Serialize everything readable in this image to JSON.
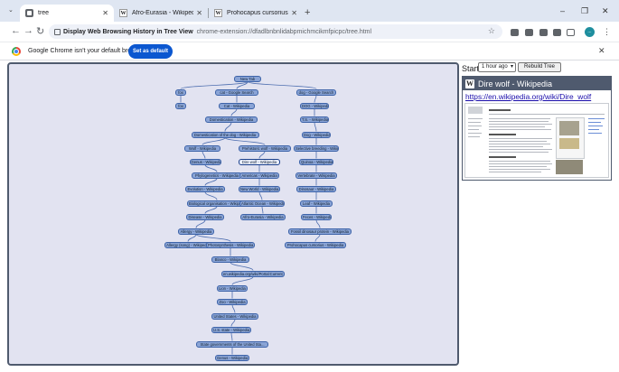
{
  "tabs": [
    {
      "title": "tree",
      "icon": "tree-extension-icon",
      "active": true
    },
    {
      "title": "Afro-Eurasia - Wikipedia",
      "icon": "wikipedia-icon",
      "active": false
    },
    {
      "title": "Prohocapus cursorius - Wikip",
      "icon": "wikipedia-icon",
      "active": false
    }
  ],
  "omnibox": {
    "chip_label": "Display Web Browsing History in Tree View",
    "url": "chrome-extension://dfadlbnbnlidabpmichmcikmfpicpc/tree.html"
  },
  "infobar": {
    "message": "Google Chrome isn't your default browser",
    "button": "Set as default"
  },
  "profile": {
    "initials": "..."
  },
  "controls": {
    "start_label": "Start",
    "start_value": "1 hour ago",
    "rebuild_label": "Rebuild Tree"
  },
  "preview": {
    "title": "Dire wolf - Wikipedia",
    "link": "https://en.wikipedia.org/wiki/Dire_wolf",
    "wiki_letter": "W"
  },
  "tree": {
    "nodes": [
      {
        "id": "root",
        "label": "New Tab"
      },
      {
        "id": "a1",
        "label": "fox",
        "parent": "root"
      },
      {
        "id": "a2",
        "label": "fox",
        "parent": "a1"
      },
      {
        "id": "b1",
        "label": "cat - Google Search",
        "parent": "root"
      },
      {
        "id": "b2",
        "label": "Cat - Wikipedia",
        "parent": "b1"
      },
      {
        "id": "b3",
        "label": "Domestication - Wikipedia",
        "parent": "b2"
      },
      {
        "id": "b4",
        "label": "Domestication of the dog - Wikipedia",
        "parent": "b3"
      },
      {
        "id": "b5",
        "label": "Wolf - Wikipedia",
        "parent": "b4"
      },
      {
        "id": "b6",
        "label": "Genus - Wikipedia",
        "parent": "b5"
      },
      {
        "id": "b7",
        "label": "Phylogenetics - Wikipedia",
        "parent": "b6"
      },
      {
        "id": "b8",
        "label": "Evolution - Wikipedia",
        "parent": "b7"
      },
      {
        "id": "b9",
        "label": "Biological organisation - Wikipedia",
        "parent": "b8"
      },
      {
        "id": "b10",
        "label": "Disease - Wikipedia",
        "parent": "b9"
      },
      {
        "id": "b11",
        "label": "Allergy - Wikipedia",
        "parent": "b10"
      },
      {
        "id": "b12a",
        "label": "Allergy (song) - Wikipedia",
        "parent": "b11"
      },
      {
        "id": "b12b",
        "label": "Photosynthesis - Wikipedia",
        "parent": "b11"
      },
      {
        "id": "b13",
        "label": "Blanco - Wikipedia",
        "parent": "b12b"
      },
      {
        "id": "b14",
        "label": "en.wikipedia.org/wiki/Portal:Current_events",
        "parent": "b13"
      },
      {
        "id": "b15",
        "label": "Lion - Wikipedia",
        "parent": "b14"
      },
      {
        "id": "b16",
        "label": "Zoo - Wikipedia",
        "parent": "b15"
      },
      {
        "id": "b17",
        "label": "United States - Wikipedia",
        "parent": "b16"
      },
      {
        "id": "b18",
        "label": "U.S. state - Wikipedia",
        "parent": "b17"
      },
      {
        "id": "b19",
        "label": "State governments of the United Sta...",
        "parent": "b18"
      },
      {
        "id": "b20",
        "label": "Genus - Wikipedia",
        "parent": "b19"
      },
      {
        "id": "c5",
        "label": "Prehistoric wolf - Wikipedia",
        "parent": "b4"
      },
      {
        "id": "c6",
        "label": "Dire wolf - Wikipedia",
        "parent": "c5",
        "selected": true
      },
      {
        "id": "c7",
        "label": "Americas - Wikipedia",
        "parent": "c6"
      },
      {
        "id": "c8",
        "label": "New World - Wikipedia",
        "parent": "c7"
      },
      {
        "id": "c9",
        "label": "Atlantic Ocean - Wikipedia",
        "parent": "c8"
      },
      {
        "id": "c10",
        "label": "Afro-Eurasia - Wikipedia",
        "parent": "c9"
      },
      {
        "id": "d1",
        "label": "dog - Google Search",
        "parent": "root"
      },
      {
        "id": "d2",
        "label": "DOG - Wikipedia",
        "parent": "d1"
      },
      {
        "id": "d3",
        "label": "T.S. - Wikipedia",
        "parent": "d2"
      },
      {
        "id": "d4",
        "label": "Dog - Wikipedia",
        "parent": "d3"
      },
      {
        "id": "d5",
        "label": "Selective breeding - Wikipedia",
        "parent": "d4"
      },
      {
        "id": "d6",
        "label": "Quinoa - Wikipedia",
        "parent": "d5"
      },
      {
        "id": "d7",
        "label": "Vertebrate - Wikipedia",
        "parent": "d6"
      },
      {
        "id": "d8",
        "label": "Dinosaur - Wikipedia",
        "parent": "d7"
      },
      {
        "id": "d9",
        "label": "Leaf - Wikipedia",
        "parent": "d8"
      },
      {
        "id": "d10",
        "label": "Feces - Wikipedia",
        "parent": "d9"
      },
      {
        "id": "d11",
        "label": "Fossil dinosaur protein - Wikipedia",
        "parent": "d10"
      },
      {
        "id": "d12",
        "label": "Prohocapus cursorius - Wikipedia",
        "parent": "d11"
      }
    ]
  }
}
